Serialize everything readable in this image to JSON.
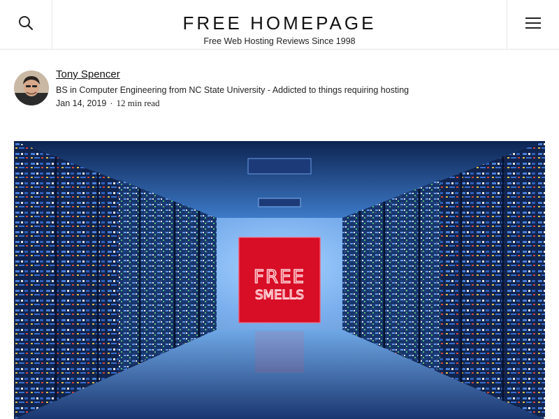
{
  "site": {
    "title": "FREE HOMEPAGE",
    "tagline": "Free Web Hosting Reviews Since 1998"
  },
  "header": {
    "search_icon": "search-icon",
    "menu_icon": "hamburger-menu-icon"
  },
  "author": {
    "name": "Tony Spencer",
    "bio": "BS in Computer Engineering from NC State University - Addicted to things requiring hosting",
    "date": "Jan 14, 2019",
    "separator": "·",
    "read_time": "12 min read"
  },
  "hero": {
    "sign_line1": "FREE",
    "sign_line2": "SMELLS"
  },
  "colors": {
    "sign_red": "#e0102a",
    "server_blue": "#1b3f8f",
    "glow": "#7fb8ff"
  }
}
